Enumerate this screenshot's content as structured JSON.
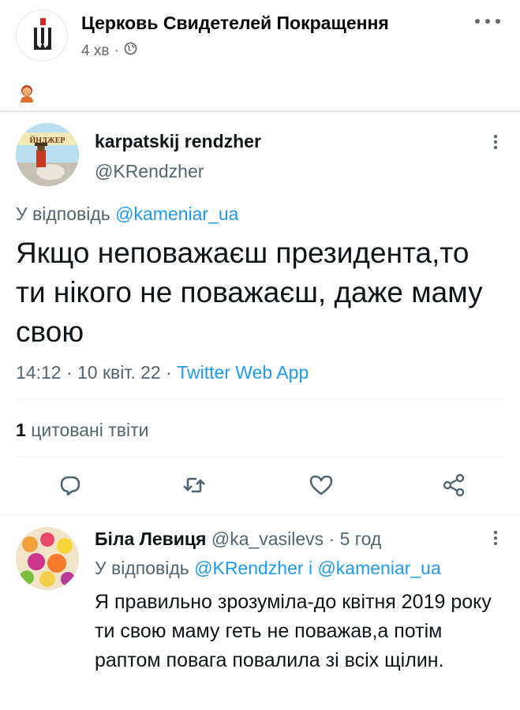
{
  "fb_post": {
    "page_name": "Церковь Свидетелей Покращення",
    "time": "4 хв",
    "separator": "·",
    "privacy_icon": "globe-icon",
    "more_icon": "more-dots-icon",
    "emoji": "person-facepalming-emoji"
  },
  "tweet": {
    "author_name": "karpatskij rendzher",
    "author_handle": "@KRendzher",
    "avatar_text": "ЙНДЖЕР",
    "replying_prefix": "У відповідь",
    "replying_to": "@kameniar_ua",
    "text": "Якщо неповажаєш президента,то ти нікого не поважаєш, даже маму свою",
    "time": "14:12",
    "date": "10 квіт. 22",
    "separator": "·",
    "source": "Twitter Web App",
    "quote_count": "1",
    "quote_label": "цитовані твіти",
    "actions": [
      "reply-icon",
      "retweet-icon",
      "like-icon",
      "share-icon"
    ]
  },
  "reply": {
    "author_name": "Біла Левиця",
    "author_handle": "@ka_vasilevs",
    "separator": "·",
    "time": "5 год",
    "replying_prefix": "У відповідь",
    "replying_to_1": "@KRendzher",
    "replying_and": "і",
    "replying_to_2": "@kameniar_ua",
    "text": "Я правильно зрозуміла-до квітня 2019 року ти свою маму геть не поважав,а потім раптом повага повалила зі всіх щілин."
  },
  "colors": {
    "link": "#1d9bf0",
    "secondary": "#536471",
    "primary_text": "#0f1419"
  }
}
